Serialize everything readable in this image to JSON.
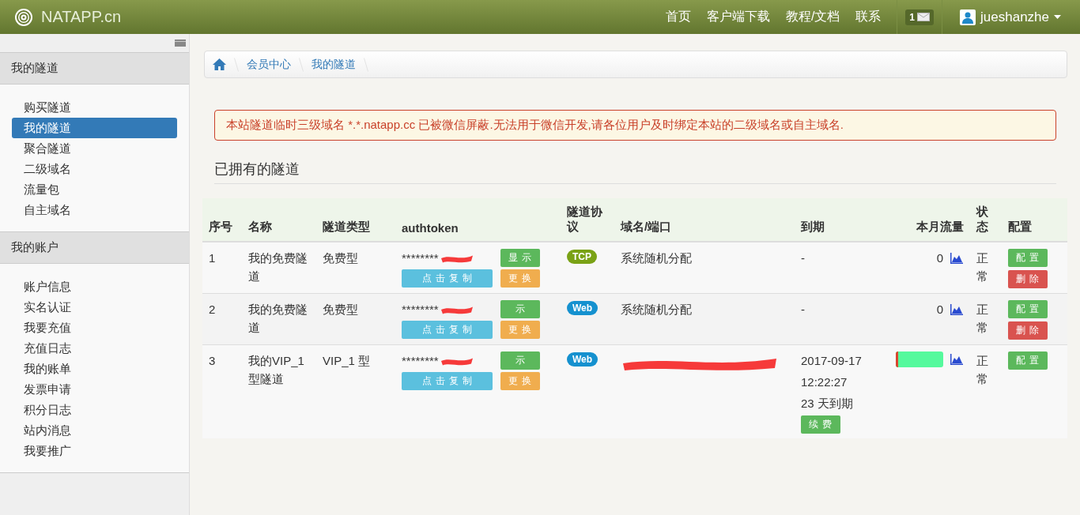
{
  "topbar": {
    "brand": "NATAPP.cn",
    "nav": [
      "首页",
      "客户端下载",
      "教程/文档",
      "联系"
    ],
    "messages": "1",
    "user": "jueshanzhe"
  },
  "sidebar": {
    "sections": [
      {
        "title": "我的隧道",
        "items": [
          {
            "label": "购买隧道",
            "selected": false
          },
          {
            "label": "我的隧道",
            "selected": true
          },
          {
            "label": "聚合隧道",
            "selected": false
          },
          {
            "label": "二级域名",
            "selected": false
          },
          {
            "label": "流量包",
            "selected": false
          },
          {
            "label": "自主域名",
            "selected": false
          }
        ]
      },
      {
        "title": "我的账户",
        "items": [
          {
            "label": "账户信息",
            "selected": false
          },
          {
            "label": "实名认证",
            "selected": false
          },
          {
            "label": "我要充值",
            "selected": false
          },
          {
            "label": "充值日志",
            "selected": false
          },
          {
            "label": "我的账单",
            "selected": false
          },
          {
            "label": "发票申请",
            "selected": false
          },
          {
            "label": "积分日志",
            "selected": false
          },
          {
            "label": "站内消息",
            "selected": false
          },
          {
            "label": "我要推广",
            "selected": false
          }
        ]
      }
    ]
  },
  "breadcrumb": [
    "会员中心",
    "我的隧道"
  ],
  "alert": "本站隧道临时三级域名 *.*.natapp.cc 已被微信屏蔽.无法用于微信开发,请各位用户及时绑定本站的二级域名或自主域名.",
  "heading": "已拥有的隧道",
  "table": {
    "columns": [
      "序号",
      "名称",
      "隧道类型",
      "authtoken",
      "隧道协议",
      "域名/端口",
      "到期",
      "本月流量",
      "状态",
      "配置"
    ],
    "rows": [
      {
        "no": "1",
        "name": "我的免费隧道",
        "type": "免费型",
        "token": "********",
        "token_redacted": true,
        "show_button": "显示",
        "copy_button": "点击复制",
        "change_button": "更换",
        "protocol": {
          "label": "TCP",
          "kind": "tcp"
        },
        "domain": {
          "text": "系统随机分配",
          "redacted": false
        },
        "expiry": [
          "-"
        ],
        "traffic": {
          "kind": "text",
          "text": "0"
        },
        "status": "正常",
        "actions": [
          {
            "label": "配置",
            "kind": "config"
          },
          {
            "label": "删除",
            "kind": "delete"
          }
        ]
      },
      {
        "no": "2",
        "name": "我的免费隧道",
        "type": "免费型",
        "token": "********",
        "token_redacted": true,
        "show_button": "示",
        "copy_button": "点击复制",
        "change_button": "更换",
        "protocol": {
          "label": "Web",
          "kind": "web"
        },
        "domain": {
          "text": "系统随机分配",
          "redacted": false
        },
        "expiry": [
          "-"
        ],
        "traffic": {
          "kind": "text",
          "text": "0"
        },
        "status": "正常",
        "actions": [
          {
            "label": "配置",
            "kind": "config"
          },
          {
            "label": "删除",
            "kind": "delete"
          }
        ]
      },
      {
        "no": "3",
        "name": "我的VIP_1型隧道",
        "type": "VIP_1 型",
        "token": "********",
        "token_redacted": true,
        "show_button": "示",
        "copy_button": "点击复制",
        "change_button": "更换",
        "protocol": {
          "label": "Web",
          "kind": "web"
        },
        "domain": {
          "redacted": true
        },
        "expiry": [
          "2017-09-17",
          "12:22:27",
          "23 天到期"
        ],
        "renew_button": "续费",
        "traffic": {
          "kind": "meter",
          "level": 0.05
        },
        "status": "正常",
        "actions": [
          {
            "label": "配置",
            "kind": "config"
          }
        ]
      }
    ]
  }
}
